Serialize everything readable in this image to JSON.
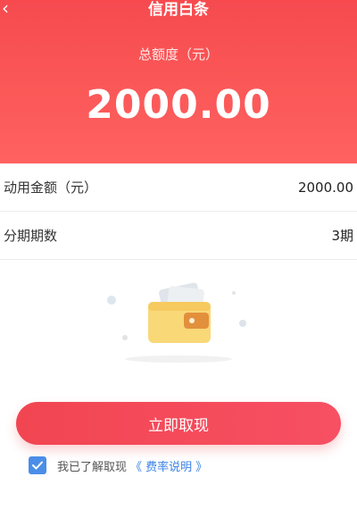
{
  "header": {
    "back_icon": "chevron-left-icon",
    "title": "信用白条"
  },
  "hero": {
    "limit_label": "总额度（元）",
    "limit_amount": "2000.00"
  },
  "rows": [
    {
      "label": "动用金额（元）",
      "value": "2000.00"
    },
    {
      "label": "分期期数",
      "value": "3期"
    }
  ],
  "illustration": {
    "icon": "wallet-icon"
  },
  "cta": {
    "label": "立即取现"
  },
  "agreement": {
    "checked": true,
    "text": "我已了解取现",
    "link": "《 费率说明 》"
  },
  "colors": {
    "brand_red": "#f64a4f",
    "button_red": "#f24552",
    "link_blue": "#3a82e6",
    "checkbox_blue": "#4a8ee8"
  }
}
